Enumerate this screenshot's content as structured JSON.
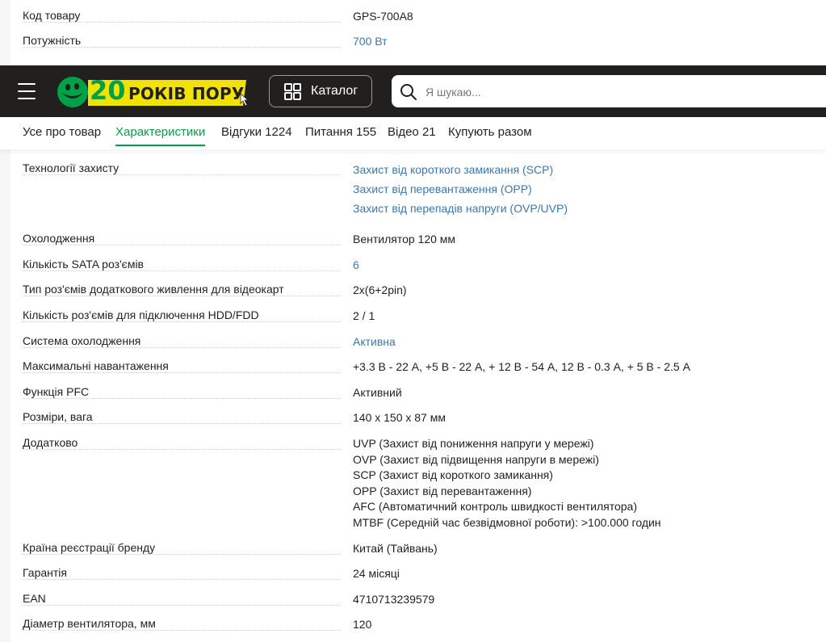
{
  "header": {
    "logo_text": "РОКІВ ПОРУЧ",
    "logo_number": "20",
    "catalog_label": "Каталог",
    "search_placeholder": "Я шукаю..."
  },
  "tabs": [
    {
      "label": "Усе про товар"
    },
    {
      "label": "Характеристики",
      "active": true
    },
    {
      "label": "Відгуки 1224"
    },
    {
      "label": "Питання 155"
    },
    {
      "label": "Відео 21"
    },
    {
      "label": "Купують разом"
    }
  ],
  "specs": [
    {
      "label": "Код товару",
      "values": [
        "GPS-700A8"
      ]
    },
    {
      "label": "Потужність",
      "values": [
        "700 Вт"
      ]
    },
    {
      "label": "Технології захисту",
      "values": [
        "Захист від короткого замикання (SCP)",
        "Захист від перевантаження (OPP)",
        "Захист від перепадів напруги (OVP/UVP)"
      ]
    },
    {
      "label": "Охолодження",
      "values": [
        "Вентилятор 120 мм"
      ]
    },
    {
      "label": "Кількість SATA роз'ємів",
      "values": [
        "6"
      ]
    },
    {
      "label": "Тип роз'ємів додаткового живлення для відеокарт",
      "values": [
        "2x(6+2pin)"
      ]
    },
    {
      "label": "Кількість роз'ємів для підключення HDD/FDD",
      "values": [
        "2 / 1"
      ]
    },
    {
      "label": "Система охолодження",
      "values": [
        "Активна"
      ]
    },
    {
      "label": "Максимальні навантаження",
      "values": [
        "+3.3 В - 22 А, +5 В - 22 А, + 12 В - 54 А, 12 В - 0.3 А, + 5 В - 2.5 А"
      ]
    },
    {
      "label": "Функція PFC",
      "values": [
        "Активний"
      ]
    },
    {
      "label": "Розміри, вага",
      "values": [
        "140 x 150 x 87 мм"
      ]
    },
    {
      "label": "Додатково",
      "values": [
        "UVP (Захист від пониження напруги у мережі)",
        "OVP (Захист від підвищення напруги в мережі)",
        "SCP (Захист від короткого замикання)",
        "OPP (Захист від перевантаження)",
        "AFC (Автоматичний контроль швидкості вентилятора)",
        "MTBF (Середній час безвідмовної роботи): >100.000 годин"
      ]
    },
    {
      "label": "Країна реєстрації бренду",
      "values": [
        "Китай (Тайвань)"
      ]
    },
    {
      "label": "Гарантія",
      "values": [
        "24 місяці"
      ]
    },
    {
      "label": "EAN",
      "values": [
        "4710713239579"
      ]
    },
    {
      "label": "Діаметр вентилятора, мм",
      "values": [
        "120"
      ]
    }
  ],
  "colors": {
    "accent": "#00a046",
    "link": "#3e77aa",
    "header_bg": "#221f1f",
    "logo_yellow": "#f2e200"
  }
}
